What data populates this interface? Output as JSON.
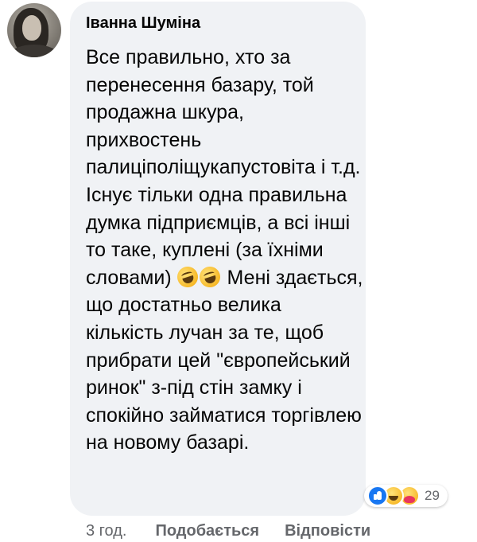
{
  "comment": {
    "author": "Іванна Шуміна",
    "text_before_emoji": "Все правильно, хто за перенесення базару, той продажна шкура, прихвостень палиціполіщукапустовіта і т.д. Існує тільки одна правильна думка підприємців, а всі інші то таке, куплені (за їхніми словами) ",
    "emojis": [
      "rolling-on-floor-laughing",
      "rolling-on-floor-laughing"
    ],
    "text_after_emoji": " Мені здається, що достатньо велика кількість лучан за те, щоб прибрати цей \"європейський ринок\" з-під стін замку і спокійно займатися торгівлею на новому базарі.",
    "reactions": {
      "icons": [
        "like-icon",
        "haha-icon",
        "care-icon"
      ],
      "count": "29"
    },
    "timestamp": "3 год.",
    "like_label": "Подобається",
    "reply_label": "Відповісти"
  },
  "colors": {
    "bubble_background": "#f0f2f5",
    "secondary_text": "#65676b",
    "like_blue": "#1877f2"
  }
}
